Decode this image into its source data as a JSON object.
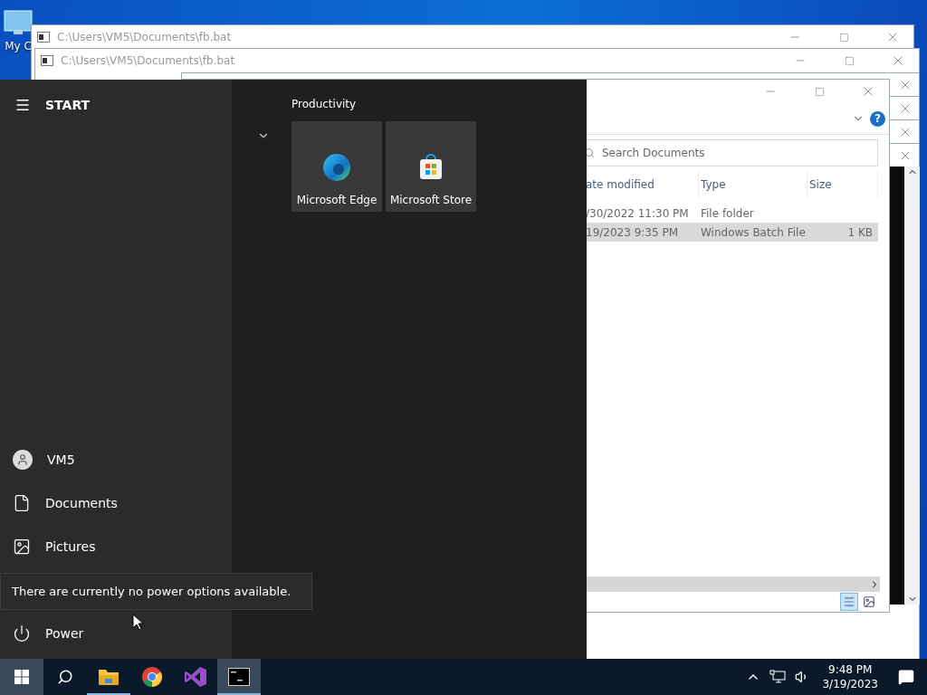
{
  "desktop": {
    "icons": [
      {
        "label": "My C"
      }
    ]
  },
  "windows": [
    {
      "title": "C:\\Users\\VM5\\Documents\\fb.bat"
    },
    {
      "title": "C:\\Users\\VM5\\Documents\\fb.bat"
    }
  ],
  "stacked_windows": [
    {
      "kind": "console"
    },
    {
      "kind": "console"
    },
    {
      "kind": "console"
    },
    {
      "kind": "console"
    }
  ],
  "explorer": {
    "help_label": "?",
    "search": {
      "placeholder": "Search Documents"
    },
    "columns": [
      "ate modified",
      "Type",
      "Size"
    ],
    "rows": [
      {
        "date": "/30/2022 11:30 PM",
        "type": "File folder",
        "selected": false
      },
      {
        "date": "19/2023 9:35 PM",
        "type": "Windows Batch File",
        "size": "1 KB",
        "selected": true
      }
    ],
    "view_buttons": [
      {
        "kind": "details",
        "selected": true
      },
      {
        "kind": "large-icons",
        "selected": false
      }
    ]
  },
  "start_menu": {
    "title": "START",
    "group": {
      "label": "Productivity",
      "tiles": [
        {
          "label": "Microsoft Edge",
          "kind": "edge"
        },
        {
          "label": "Microsoft Store",
          "kind": "store"
        }
      ]
    },
    "items": [
      {
        "label": "VM5",
        "kind": "user"
      },
      {
        "label": "Documents",
        "kind": "documents"
      },
      {
        "label": "Pictures",
        "kind": "pictures"
      },
      {
        "label": "Power",
        "kind": "power"
      }
    ],
    "tooltip": "There are currently no power options available."
  },
  "taskbar": {
    "apps": [
      {
        "kind": "explorer",
        "running": true,
        "active": false
      },
      {
        "kind": "chrome",
        "running": false,
        "active": false
      },
      {
        "kind": "visual-studio",
        "running": false,
        "active": false
      },
      {
        "kind": "console",
        "running": true,
        "active": true
      }
    ],
    "tray": {
      "time": "9:48 PM",
      "date": "3/19/2023"
    }
  }
}
